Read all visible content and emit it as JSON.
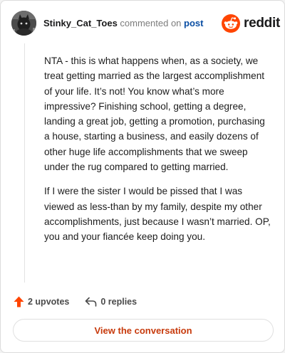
{
  "header": {
    "username": "Stinky_Cat_Toes",
    "commented_on": "commented on",
    "post_link": "post",
    "brand": "reddit"
  },
  "comment": {
    "paragraphs": [
      "NTA - this is what happens when, as a society, we treat getting married as the largest accomplishment of your life. It’s not! You know what’s more impressive? Finishing school, getting a degree, landing a great job, getting a promotion, purchasing a house, starting a business, and easily dozens of other huge life accomplishments that we sweep under the rug compared to getting married.",
      "If I were the sister I would be pissed that I was viewed as less-than by my family, despite my other accomplishments, just because I wasn’t married. OP, you and your fiancée keep doing you."
    ]
  },
  "actions": {
    "upvotes": "2 upvotes",
    "replies": "0 replies"
  },
  "footer": {
    "view_conversation": "View the conversation"
  },
  "icons": {
    "avatar": "user-avatar-icon",
    "brand": "reddit-snoo-icon",
    "upvote": "upvote-arrow-icon",
    "reply": "reply-arrow-icon"
  },
  "colors": {
    "brand_orange": "#ff4500",
    "link_blue": "#0a4ea3",
    "button_text": "#c73a0c"
  }
}
